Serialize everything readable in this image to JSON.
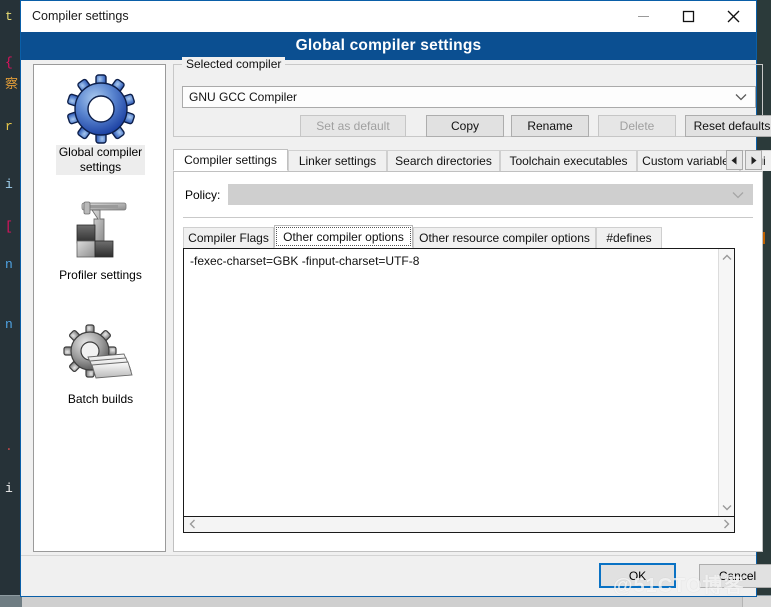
{
  "window": {
    "title": "Compiler settings",
    "banner": "Global compiler settings",
    "minimize_icon": "minimize-icon",
    "maximize_icon": "maximize-icon",
    "close_icon": "close-icon",
    "accent_color": "#0b4f91"
  },
  "sidebar": {
    "items": [
      {
        "label": "Global compiler\nsettings",
        "icon": "blue-gear-icon",
        "selected": true
      },
      {
        "label": "Profiler settings",
        "icon": "caliper-blocks-icon",
        "selected": false
      },
      {
        "label": "Batch builds",
        "icon": "gear-stack-icon",
        "selected": false
      }
    ]
  },
  "selected_compiler": {
    "group_title": "Selected compiler",
    "combo_value": "GNU GCC Compiler",
    "combo_caret_icon": "chevron-down-icon",
    "buttons": [
      {
        "label": "Set as default",
        "disabled": true
      },
      {
        "label": "Copy",
        "disabled": false
      },
      {
        "label": "Rename",
        "disabled": false
      },
      {
        "label": "Delete",
        "disabled": true
      },
      {
        "label": "Reset defaults",
        "disabled": false
      }
    ]
  },
  "tabs": {
    "items": [
      {
        "label": "Compiler settings",
        "active": true
      },
      {
        "label": "Linker settings",
        "active": false
      },
      {
        "label": "Search directories",
        "active": false
      },
      {
        "label": "Toolchain executables",
        "active": false
      },
      {
        "label": "Custom variables",
        "active": false
      },
      {
        "label": "Bui",
        "active": false
      }
    ],
    "nav_prev_icon": "triangle-left-icon",
    "nav_next_icon": "triangle-right-icon"
  },
  "policy": {
    "label": "Policy:",
    "value": "",
    "caret_icon": "chevron-down-icon"
  },
  "inner_tabs": {
    "items": [
      {
        "label": "Compiler Flags",
        "active": false
      },
      {
        "label": "Other compiler options",
        "active": true
      },
      {
        "label": "Other resource compiler options",
        "active": false
      },
      {
        "label": "#defines",
        "active": false
      }
    ]
  },
  "editor": {
    "value": "-fexec-charset=GBK -finput-charset=UTF-8",
    "vscroll_up_icon": "chevron-up-icon",
    "vscroll_down_icon": "chevron-down-icon",
    "hscroll_left_icon": "chevron-left-icon",
    "hscroll_right_icon": "chevron-right-icon"
  },
  "footer": {
    "ok_label": "OK",
    "cancel_label": "Cancel"
  },
  "watermark": "@51CTO博客",
  "background_code": [
    {
      "text": "t",
      "color": "#e6db74"
    },
    {
      "text": "{",
      "color": "#e0115f"
    },
    {
      "text": "察",
      "color": "#e09c38"
    },
    {
      "text": "r",
      "color": "#e6c74a"
    },
    {
      "text": "i",
      "color": "#9fd0ee"
    },
    {
      "text": "[",
      "color": "#e0115f"
    },
    {
      "text": "n",
      "color": "#4fa3e3"
    },
    {
      "text": "n",
      "color": "#4fa3e3"
    },
    {
      "text": ".",
      "color": "#c04a4a"
    },
    {
      "text": "i",
      "color": "#f0f0f0"
    }
  ]
}
